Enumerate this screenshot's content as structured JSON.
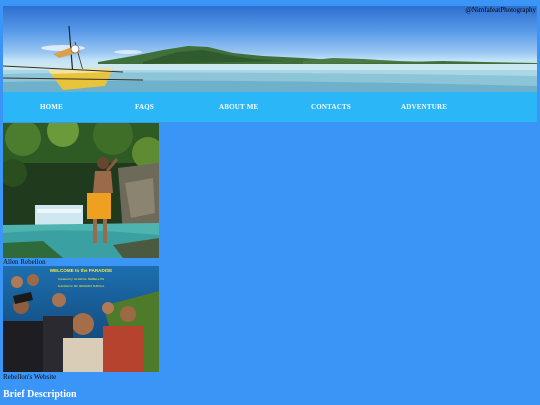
{
  "banner": {
    "credit": "@NimfafeatPhotography"
  },
  "nav": {
    "items": [
      {
        "label": "HOME"
      },
      {
        "label": "FAQS"
      },
      {
        "label": "ABOUT ME"
      },
      {
        "label": "CONTACTS"
      },
      {
        "label": "ADVENTURE"
      }
    ]
  },
  "gallery": {
    "caption1": "Allen Rebellon",
    "caption2": "Rebellon's Website",
    "poster_text": {
      "title": "WELCOME to the PARADISE",
      "line1": "Created by: ALLEN E. REBELLON",
      "line2": "Submitted to: DR. ARMANDO SURIOLA"
    }
  },
  "section": {
    "heading": "Brief Description"
  }
}
